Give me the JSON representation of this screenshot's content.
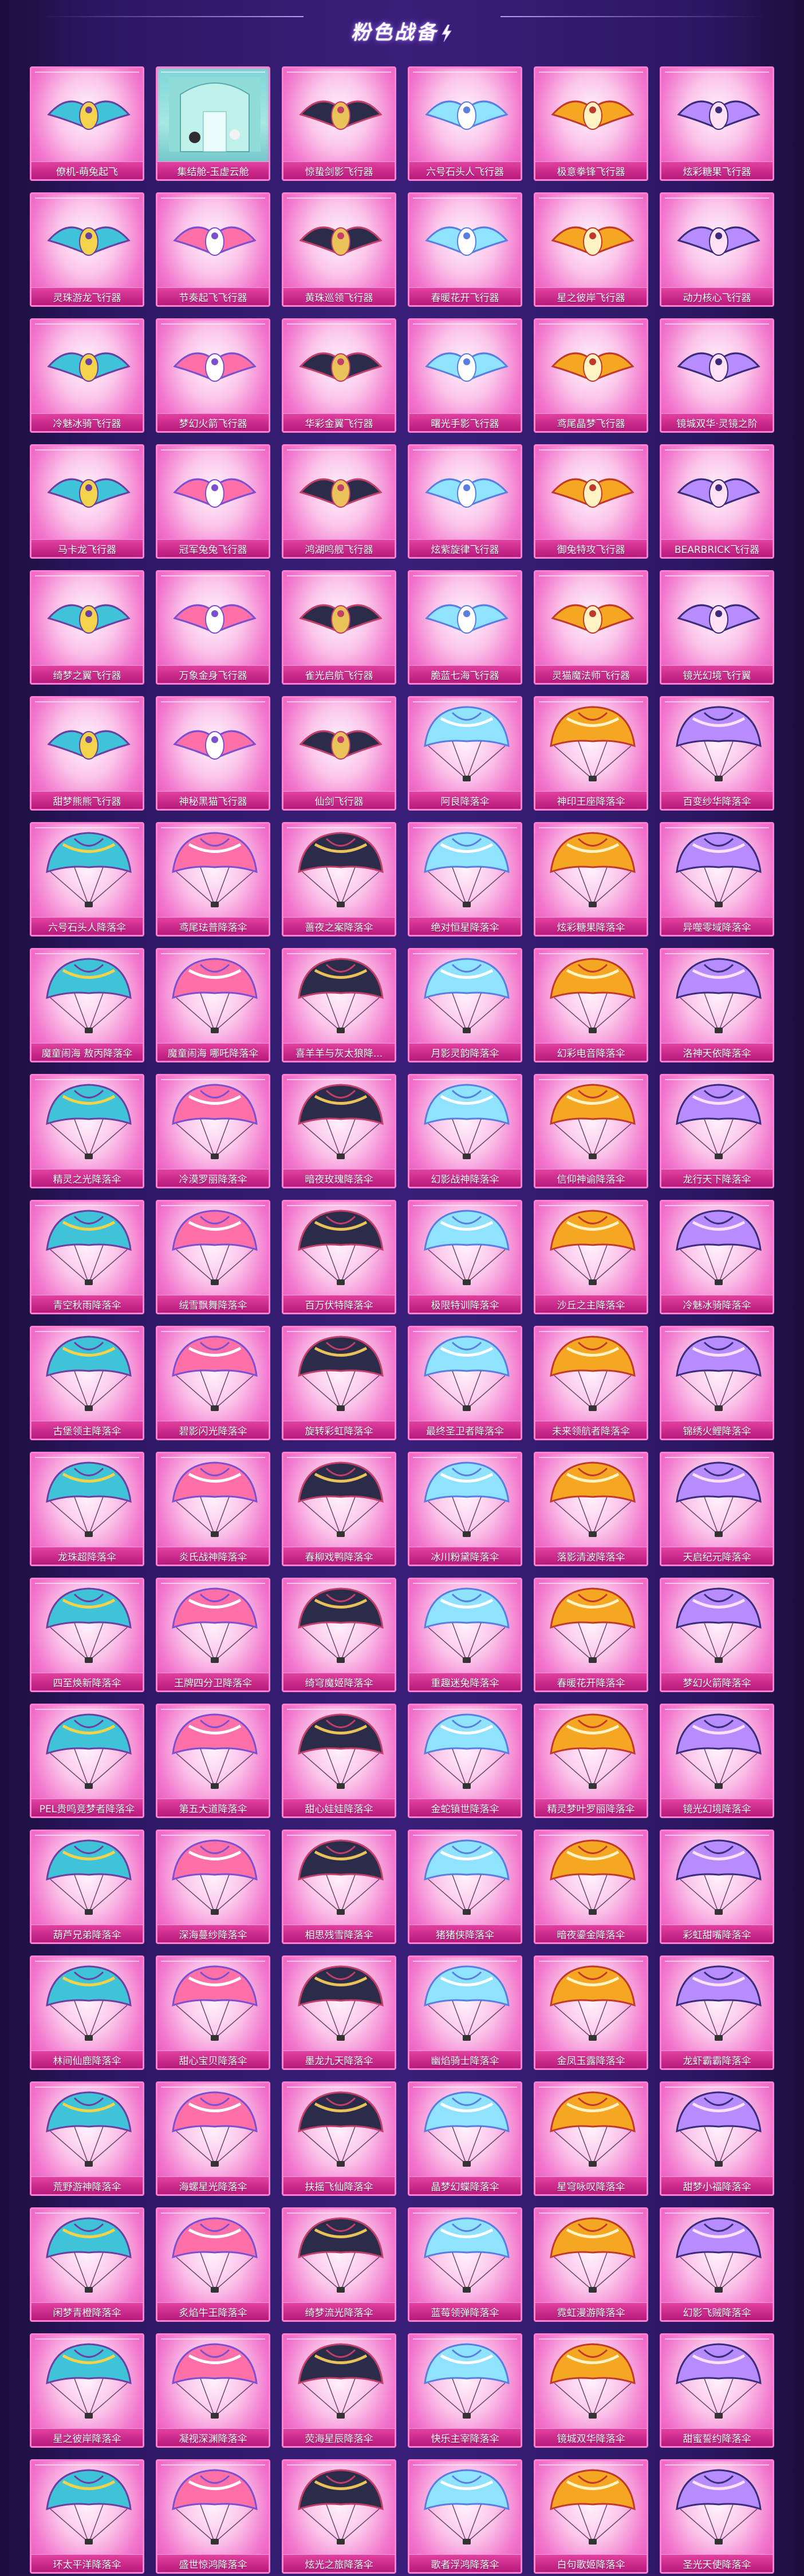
{
  "page": {
    "title": "粉色战备"
  },
  "colors": {
    "background": "#2c1763",
    "card_border": "#ff7fd0",
    "label_bar": "#c42285",
    "title_glow": "#a46bff"
  },
  "items": [
    {
      "name": "僚机-萌兔起飞",
      "kind": "glider",
      "icon": "bunny-glider-icon"
    },
    {
      "name": "集结舱-玉虚云舱",
      "kind": "scene",
      "icon": "pod-scene-icon"
    },
    {
      "name": "惊蛰剑影飞行器",
      "kind": "glider",
      "icon": "swords-glider-icon"
    },
    {
      "name": "六号石头人飞行器",
      "kind": "glider",
      "icon": "golem-glider-icon"
    },
    {
      "name": "极意拳锋飞行器",
      "kind": "glider",
      "icon": "fist-glider-icon"
    },
    {
      "name": "炫彩糖果飞行器",
      "kind": "glider",
      "icon": "candy-glider-icon"
    },
    {
      "name": "灵珠游龙飞行器",
      "kind": "glider",
      "icon": "dragon-glider-icon"
    },
    {
      "name": "节奏起飞飞行器",
      "kind": "glider",
      "icon": "rhythm-glider-icon"
    },
    {
      "name": "黄珠巡领飞行器",
      "kind": "glider",
      "icon": "golden-dragon-glider-icon"
    },
    {
      "name": "春暖花开飞行器",
      "kind": "glider",
      "icon": "flower-glider-icon"
    },
    {
      "name": "星之彼岸飞行器",
      "kind": "glider",
      "icon": "star-wing-glider-icon"
    },
    {
      "name": "动力核心飞行器",
      "kind": "glider",
      "icon": "core-glider-icon"
    },
    {
      "name": "冷魅冰骑飞行器",
      "kind": "glider",
      "icon": "ice-glider-icon"
    },
    {
      "name": "梦幻火箭飞行器",
      "kind": "glider",
      "icon": "rocket-glider-icon"
    },
    {
      "name": "华彩金翼飞行器",
      "kind": "glider",
      "icon": "gold-wing-glider-icon"
    },
    {
      "name": "曙光手影飞行器",
      "kind": "glider",
      "icon": "hand-glider-icon"
    },
    {
      "name": "鸢尾晶梦飞行器",
      "kind": "glider",
      "icon": "crystal-glider-icon"
    },
    {
      "name": "镜城双华·灵镜之阶",
      "kind": "glider",
      "icon": "mirror-glider-icon"
    },
    {
      "name": "马卡龙飞行器",
      "kind": "glider",
      "icon": "macaron-glider-icon"
    },
    {
      "name": "冠军兔兔飞行器",
      "kind": "glider",
      "icon": "champion-glider-icon"
    },
    {
      "name": "鸿湖鸣舰飞行器",
      "kind": "glider",
      "icon": "warship-glider-icon"
    },
    {
      "name": "炫紫旋律飞行器",
      "kind": "glider",
      "icon": "violet-glider-icon"
    },
    {
      "name": "御兔特攻飞行器",
      "kind": "glider",
      "icon": "rabbit-mech-glider-icon"
    },
    {
      "name": "BEARBRICK飞行器",
      "kind": "glider",
      "icon": "bearbrick-glider-icon"
    },
    {
      "name": "绮梦之翼飞行器",
      "kind": "glider",
      "icon": "dream-wing-glider-icon"
    },
    {
      "name": "万象金身飞行器",
      "kind": "glider",
      "icon": "golden-body-glider-icon"
    },
    {
      "name": "雀光启航飞行器",
      "kind": "glider",
      "icon": "sparrow-glider-icon"
    },
    {
      "name": "脆蓝七海飞行器",
      "kind": "glider",
      "icon": "sea-glider-icon"
    },
    {
      "name": "灵猫魔法师飞行器",
      "kind": "glider",
      "icon": "cat-glider-icon"
    },
    {
      "name": "镜光幻境飞行翼",
      "kind": "glider",
      "icon": "mirror-wing-glider-icon"
    },
    {
      "name": "甜梦熊熊飞行器",
      "kind": "glider",
      "icon": "bear-glider-icon"
    },
    {
      "name": "神秘黑猫飞行器",
      "kind": "glider",
      "icon": "black-cat-glider-icon"
    },
    {
      "name": "仙剑飞行器",
      "kind": "glider",
      "icon": "sword-glider-icon"
    },
    {
      "name": "阿良降落伞",
      "kind": "parachute",
      "icon": "parachute-icon"
    },
    {
      "name": "神印王座降落伞",
      "kind": "parachute",
      "icon": "parachute-icon"
    },
    {
      "name": "百变纱华降落伞",
      "kind": "parachute",
      "icon": "parachute-icon"
    },
    {
      "name": "六号石头人降落伞",
      "kind": "parachute",
      "icon": "parachute-icon"
    },
    {
      "name": "鸢尾珐普降落伞",
      "kind": "parachute",
      "icon": "parachute-icon"
    },
    {
      "name": "蔷夜之案降落伞",
      "kind": "parachute",
      "icon": "parachute-icon"
    },
    {
      "name": "绝对恒星降落伞",
      "kind": "parachute",
      "icon": "parachute-icon"
    },
    {
      "name": "炫彩糖果降落伞",
      "kind": "parachute",
      "icon": "parachute-icon"
    },
    {
      "name": "异噬零域降落伞",
      "kind": "parachute",
      "icon": "parachute-icon"
    },
    {
      "name": "魔童闹海 敖丙降落伞",
      "kind": "parachute",
      "icon": "parachute-icon"
    },
    {
      "name": "魔童闹海 哪吒降落伞",
      "kind": "parachute",
      "icon": "parachute-icon"
    },
    {
      "name": "喜羊羊与灰太狼降...",
      "kind": "parachute",
      "icon": "parachute-icon"
    },
    {
      "name": "月影灵韵降落伞",
      "kind": "parachute",
      "icon": "parachute-icon"
    },
    {
      "name": "幻彩电音降落伞",
      "kind": "parachute",
      "icon": "parachute-icon"
    },
    {
      "name": "洛神天依降落伞",
      "kind": "parachute",
      "icon": "parachute-icon"
    },
    {
      "name": "精灵之光降落伞",
      "kind": "parachute",
      "icon": "parachute-icon"
    },
    {
      "name": "冷漠罗丽降落伞",
      "kind": "parachute",
      "icon": "parachute-icon"
    },
    {
      "name": "暗夜玫瑰降落伞",
      "kind": "parachute",
      "icon": "parachute-icon"
    },
    {
      "name": "幻影战神降落伞",
      "kind": "parachute",
      "icon": "parachute-icon"
    },
    {
      "name": "信仰神谕降落伞",
      "kind": "parachute",
      "icon": "parachute-icon"
    },
    {
      "name": "龙行天下降落伞",
      "kind": "parachute",
      "icon": "parachute-icon"
    },
    {
      "name": "青空秋雨降落伞",
      "kind": "parachute",
      "icon": "parachute-icon"
    },
    {
      "name": "绒雪飘舞降落伞",
      "kind": "parachute",
      "icon": "parachute-icon"
    },
    {
      "name": "百万伏特降落伞",
      "kind": "parachute",
      "icon": "parachute-icon"
    },
    {
      "name": "极限特训降落伞",
      "kind": "parachute",
      "icon": "parachute-icon"
    },
    {
      "name": "沙丘之主降落伞",
      "kind": "parachute",
      "icon": "parachute-icon"
    },
    {
      "name": "冷魅冰骑降落伞",
      "kind": "parachute",
      "icon": "parachute-icon"
    },
    {
      "name": "古堡领主降落伞",
      "kind": "parachute",
      "icon": "parachute-icon"
    },
    {
      "name": "碧影闪光降落伞",
      "kind": "parachute",
      "icon": "parachute-icon"
    },
    {
      "name": "旋转彩虹降落伞",
      "kind": "parachute",
      "icon": "parachute-icon"
    },
    {
      "name": "最终圣卫者降落伞",
      "kind": "parachute",
      "icon": "parachute-icon"
    },
    {
      "name": "未来领航者降落伞",
      "kind": "parachute",
      "icon": "parachute-icon"
    },
    {
      "name": "锦绣火鲤降落伞",
      "kind": "parachute",
      "icon": "parachute-icon"
    },
    {
      "name": "龙珠超降落伞",
      "kind": "parachute",
      "icon": "parachute-icon"
    },
    {
      "name": "炎氏战神降落伞",
      "kind": "parachute",
      "icon": "parachute-icon"
    },
    {
      "name": "春柳戏鸭降落伞",
      "kind": "parachute",
      "icon": "parachute-icon"
    },
    {
      "name": "冰川粉黛降落伞",
      "kind": "parachute",
      "icon": "parachute-icon"
    },
    {
      "name": "落影清波降落伞",
      "kind": "parachute",
      "icon": "parachute-icon"
    },
    {
      "name": "天启纪元降落伞",
      "kind": "parachute",
      "icon": "parachute-icon"
    },
    {
      "name": "四至焕新降落伞",
      "kind": "parachute",
      "icon": "parachute-icon"
    },
    {
      "name": "王牌四分卫降落伞",
      "kind": "parachute",
      "icon": "parachute-icon"
    },
    {
      "name": "绮穹魔姬降落伞",
      "kind": "parachute",
      "icon": "parachute-icon"
    },
    {
      "name": "重趣迷兔降落伞",
      "kind": "parachute",
      "icon": "parachute-icon"
    },
    {
      "name": "春暖花开降落伞",
      "kind": "parachute",
      "icon": "parachute-icon"
    },
    {
      "name": "梦幻火箭降落伞",
      "kind": "parachute",
      "icon": "parachute-icon"
    },
    {
      "name": "PEL贵鸣竞梦者降落伞",
      "kind": "parachute",
      "icon": "parachute-icon"
    },
    {
      "name": "第五大道降落伞",
      "kind": "parachute",
      "icon": "parachute-icon"
    },
    {
      "name": "甜心娃娃降落伞",
      "kind": "parachute",
      "icon": "parachute-icon"
    },
    {
      "name": "金蛇镇世降落伞",
      "kind": "parachute",
      "icon": "parachute-icon"
    },
    {
      "name": "精灵梦叶罗丽降落伞",
      "kind": "parachute",
      "icon": "parachute-icon"
    },
    {
      "name": "镜光幻境降落伞",
      "kind": "parachute",
      "icon": "parachute-icon"
    },
    {
      "name": "葫芦兄弟降落伞",
      "kind": "parachute",
      "icon": "parachute-icon"
    },
    {
      "name": "深海蔓纱降落伞",
      "kind": "parachute",
      "icon": "parachute-icon"
    },
    {
      "name": "相思残雪降落伞",
      "kind": "parachute",
      "icon": "parachute-icon"
    },
    {
      "name": "猪猪侠降落伞",
      "kind": "parachute",
      "icon": "parachute-icon"
    },
    {
      "name": "暗夜鎏金降落伞",
      "kind": "parachute",
      "icon": "parachute-icon"
    },
    {
      "name": "彩虹甜嘴降落伞",
      "kind": "parachute",
      "icon": "parachute-icon"
    },
    {
      "name": "林间仙鹿降落伞",
      "kind": "parachute",
      "icon": "parachute-icon"
    },
    {
      "name": "甜心宝贝降落伞",
      "kind": "parachute",
      "icon": "parachute-icon"
    },
    {
      "name": "墨龙九天降落伞",
      "kind": "parachute",
      "icon": "parachute-icon"
    },
    {
      "name": "幽焰骑士降落伞",
      "kind": "parachute",
      "icon": "parachute-icon"
    },
    {
      "name": "金凤玉露降落伞",
      "kind": "parachute",
      "icon": "parachute-icon"
    },
    {
      "name": "龙虾霸霸降落伞",
      "kind": "parachute",
      "icon": "parachute-icon"
    },
    {
      "name": "荒野游神降落伞",
      "kind": "parachute",
      "icon": "parachute-icon"
    },
    {
      "name": "海螺星光降落伞",
      "kind": "parachute",
      "icon": "parachute-icon"
    },
    {
      "name": "扶摇飞仙降落伞",
      "kind": "parachute",
      "icon": "parachute-icon"
    },
    {
      "name": "晶梦幻蝶降落伞",
      "kind": "parachute",
      "icon": "parachute-icon"
    },
    {
      "name": "星穹咏叹降落伞",
      "kind": "parachute",
      "icon": "parachute-icon"
    },
    {
      "name": "甜梦小福降落伞",
      "kind": "parachute",
      "icon": "parachute-icon"
    },
    {
      "name": "闲梦青橙降落伞",
      "kind": "parachute",
      "icon": "parachute-icon"
    },
    {
      "name": "炙焰牛王降落伞",
      "kind": "parachute",
      "icon": "parachute-icon"
    },
    {
      "name": "绮梦流光降落伞",
      "kind": "parachute",
      "icon": "parachute-icon"
    },
    {
      "name": "蓝莓领弹降落伞",
      "kind": "parachute",
      "icon": "parachute-icon"
    },
    {
      "name": "霓虹漫游降落伞",
      "kind": "parachute",
      "icon": "parachute-icon"
    },
    {
      "name": "幻影飞贼降落伞",
      "kind": "parachute",
      "icon": "parachute-icon"
    },
    {
      "name": "星之彼岸降落伞",
      "kind": "parachute",
      "icon": "parachute-icon"
    },
    {
      "name": "凝视深渊降落伞",
      "kind": "parachute",
      "icon": "parachute-icon"
    },
    {
      "name": "荧海星辰降落伞",
      "kind": "parachute",
      "icon": "parachute-icon"
    },
    {
      "name": "快乐主宰降落伞",
      "kind": "parachute",
      "icon": "parachute-icon"
    },
    {
      "name": "镜城双华降落伞",
      "kind": "parachute",
      "icon": "parachute-icon"
    },
    {
      "name": "甜蜜誓约降落伞",
      "kind": "parachute",
      "icon": "parachute-icon"
    },
    {
      "name": "环太平洋降落伞",
      "kind": "parachute",
      "icon": "parachute-icon"
    },
    {
      "name": "盛世惊鸿降落伞",
      "kind": "parachute",
      "icon": "parachute-icon"
    },
    {
      "name": "炫光之旅降落伞",
      "kind": "parachute",
      "icon": "parachute-icon"
    },
    {
      "name": "歌者浮鸿降落伞",
      "kind": "parachute",
      "icon": "parachute-icon"
    },
    {
      "name": "白句歌姬降落伞",
      "kind": "parachute",
      "icon": "parachute-icon"
    },
    {
      "name": "圣光天使降落伞",
      "kind": "parachute",
      "icon": "parachute-icon"
    }
  ]
}
